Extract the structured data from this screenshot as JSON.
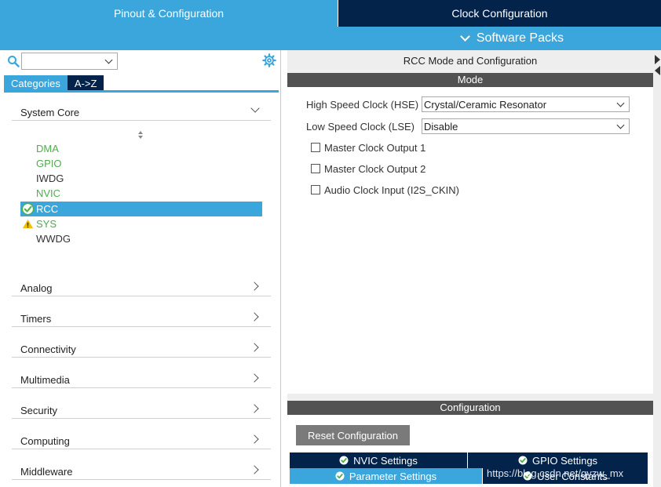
{
  "top_tabs": {
    "pinout": "Pinout & Configuration",
    "clock": "Clock Configuration"
  },
  "software_packs": "Software Packs",
  "left": {
    "category_tabs": [
      "Categories",
      "A->Z"
    ],
    "categories": {
      "system_core": "System Core",
      "analog": "Analog",
      "timers": "Timers",
      "connectivity": "Connectivity",
      "multimedia": "Multimedia",
      "security": "Security",
      "computing": "Computing",
      "middleware": "Middleware"
    },
    "peripherals": [
      "DMA",
      "GPIO",
      "IWDG",
      "NVIC",
      "RCC",
      "SYS",
      "WWDG"
    ]
  },
  "right": {
    "title": "RCC Mode and Configuration",
    "mode_label": "Mode",
    "hse_label": "High Speed Clock (HSE)",
    "hse_value": "Crystal/Ceramic Resonator",
    "lse_label": "Low Speed Clock (LSE)",
    "lse_value": "Disable",
    "checkboxes": [
      "Master Clock Output 1",
      "Master Clock Output 2",
      "Audio Clock Input (I2S_CKIN)"
    ],
    "config_label": "Configuration",
    "reset_button": "Reset Configuration",
    "tabs": {
      "nvic": "NVIC Settings",
      "gpio": "GPIO Settings",
      "param": "Parameter Settings",
      "user": "User Constants"
    }
  },
  "watermark": "https://blog.csdn.net/qyzw_mx",
  "colors": {
    "accent_blue": "#3ba6dc",
    "dark_navy": "#03234b",
    "green": "#4cae4c",
    "warning": "#f0c000"
  },
  "icons": {
    "search": "search-icon",
    "gear": "gear-icon",
    "check": "check-circle-icon",
    "warning": "warning-icon"
  }
}
